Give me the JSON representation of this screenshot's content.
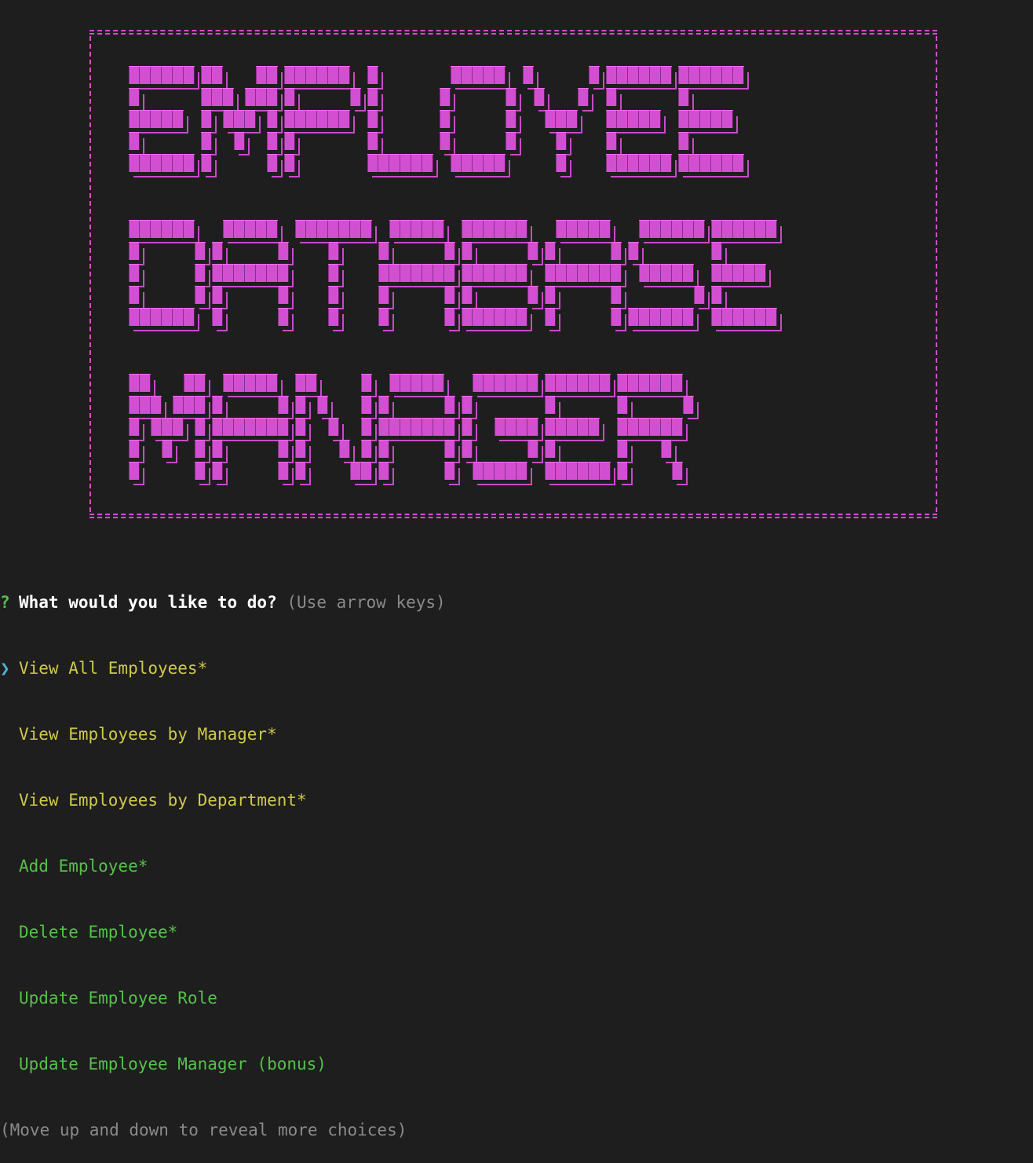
{
  "banner": {
    "lines": [
      "EMPLOYEE",
      "DATABASE",
      "MANAGER"
    ],
    "color": "#d24fd2"
  },
  "prompt": {
    "marker": "?",
    "question": "What would you like to do?",
    "hint": "(Use arrow keys)",
    "pointer": "❯",
    "choices": [
      {
        "label": "View All Employees*",
        "color": "#cfc94a",
        "selected": true
      },
      {
        "label": "View Employees by Manager*",
        "color": "#cfc94a",
        "selected": false
      },
      {
        "label": "View Employees by Department*",
        "color": "#cfc94a",
        "selected": false
      },
      {
        "label": "Add Employee*",
        "color": "#55c14b",
        "selected": false
      },
      {
        "label": "Delete Employee*",
        "color": "#55c14b",
        "selected": false
      },
      {
        "label": "Update Employee Role",
        "color": "#55c14b",
        "selected": false
      },
      {
        "label": "Update Employee Manager (bonus)",
        "color": "#55c14b",
        "selected": false
      }
    ],
    "footer": "(Move up and down to reveal more choices)"
  }
}
